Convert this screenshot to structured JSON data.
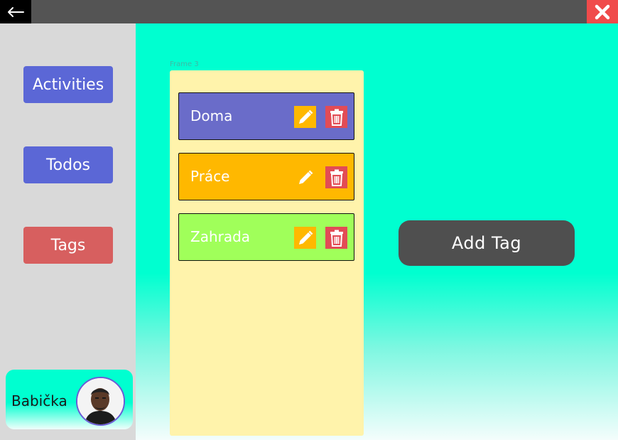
{
  "titlebar": {
    "back_icon": "arrow-left-icon",
    "close_icon": "close-icon"
  },
  "sidebar": {
    "items": [
      {
        "label": "Activities",
        "color": "#5b67d6"
      },
      {
        "label": "Todos",
        "color": "#5b67d6"
      },
      {
        "label": "Tags",
        "color": "#d75f5f"
      }
    ],
    "user": {
      "name": "Babička"
    }
  },
  "main": {
    "frame_label": "Frame 3",
    "tags": [
      {
        "label": "Doma",
        "color": "#6a6cc9"
      },
      {
        "label": "Práce",
        "color": "#ffb800"
      },
      {
        "label": "Zahrada",
        "color": "#a0ff5a"
      }
    ],
    "add_tag_label": "Add Tag"
  },
  "colors": {
    "accent": "#00ffd0",
    "edit_bg": "#ffb800",
    "delete_bg": "#e24c55"
  }
}
